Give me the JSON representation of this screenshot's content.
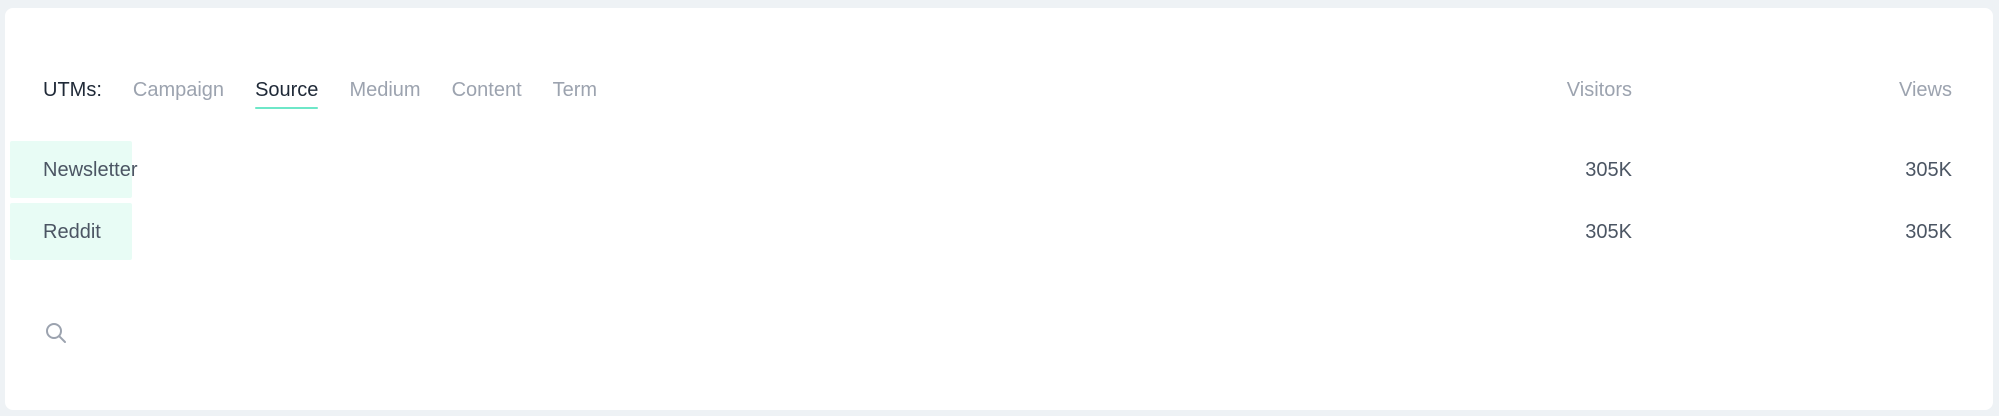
{
  "header": {
    "utm_label": "UTMs:",
    "tabs": [
      {
        "label": "Campaign",
        "active": false
      },
      {
        "label": "Source",
        "active": true
      },
      {
        "label": "Medium",
        "active": false
      },
      {
        "label": "Content",
        "active": false
      },
      {
        "label": "Term",
        "active": false
      }
    ],
    "visitors_label": "Visitors",
    "views_label": "Views"
  },
  "rows": [
    {
      "name": "Newsletter",
      "visitors": "305K",
      "views": "305K",
      "share": 0.063
    },
    {
      "name": "Reddit",
      "visitors": "305K",
      "views": "305K",
      "share": 0.063
    }
  ],
  "search": {
    "icon": "search-icon"
  },
  "colors": {
    "accent_underline": "#6ee7c8",
    "row_bar": "#e8fcf5",
    "muted_text": "#9ca3af",
    "primary_text": "#1f2937"
  }
}
